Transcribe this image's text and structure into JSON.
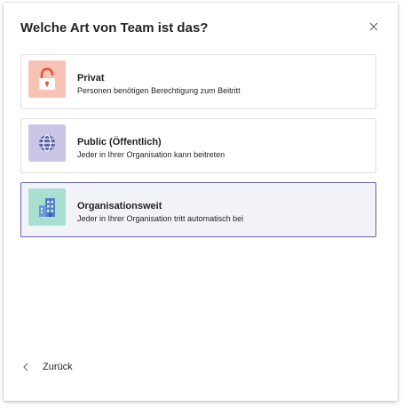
{
  "dialog": {
    "title": "Welche Art von Team ist das?",
    "close_icon": "close-icon"
  },
  "options": [
    {
      "name": "Privat",
      "description": "Personen benötigen Berechtigung zum Beitritt",
      "icon": "lock-icon",
      "icon_bg": "#f8c3b4",
      "icon_color": "#e5533b",
      "selected": false
    },
    {
      "name": "Public (Öffentlich)",
      "description": "Jeder in Ihrer Organisation kann beitreten",
      "icon": "globe-icon",
      "icon_bg": "#c9c6e6",
      "icon_color": "#6264a7",
      "selected": false
    },
    {
      "name": "Organisationsweit",
      "description": "Jeder in Ihrer Organisation tritt automatisch bei",
      "icon": "building-icon",
      "icon_bg": "#a9dfd2",
      "icon_color": "#4f80c4",
      "selected": true
    }
  ],
  "footer": {
    "back_label": "Zurück",
    "back_icon": "chevron-left-icon"
  },
  "colors": {
    "accent": "#6264a7",
    "selected_bg": "#f2f2f9",
    "text": "#252423",
    "border": "#e1dfdd"
  }
}
